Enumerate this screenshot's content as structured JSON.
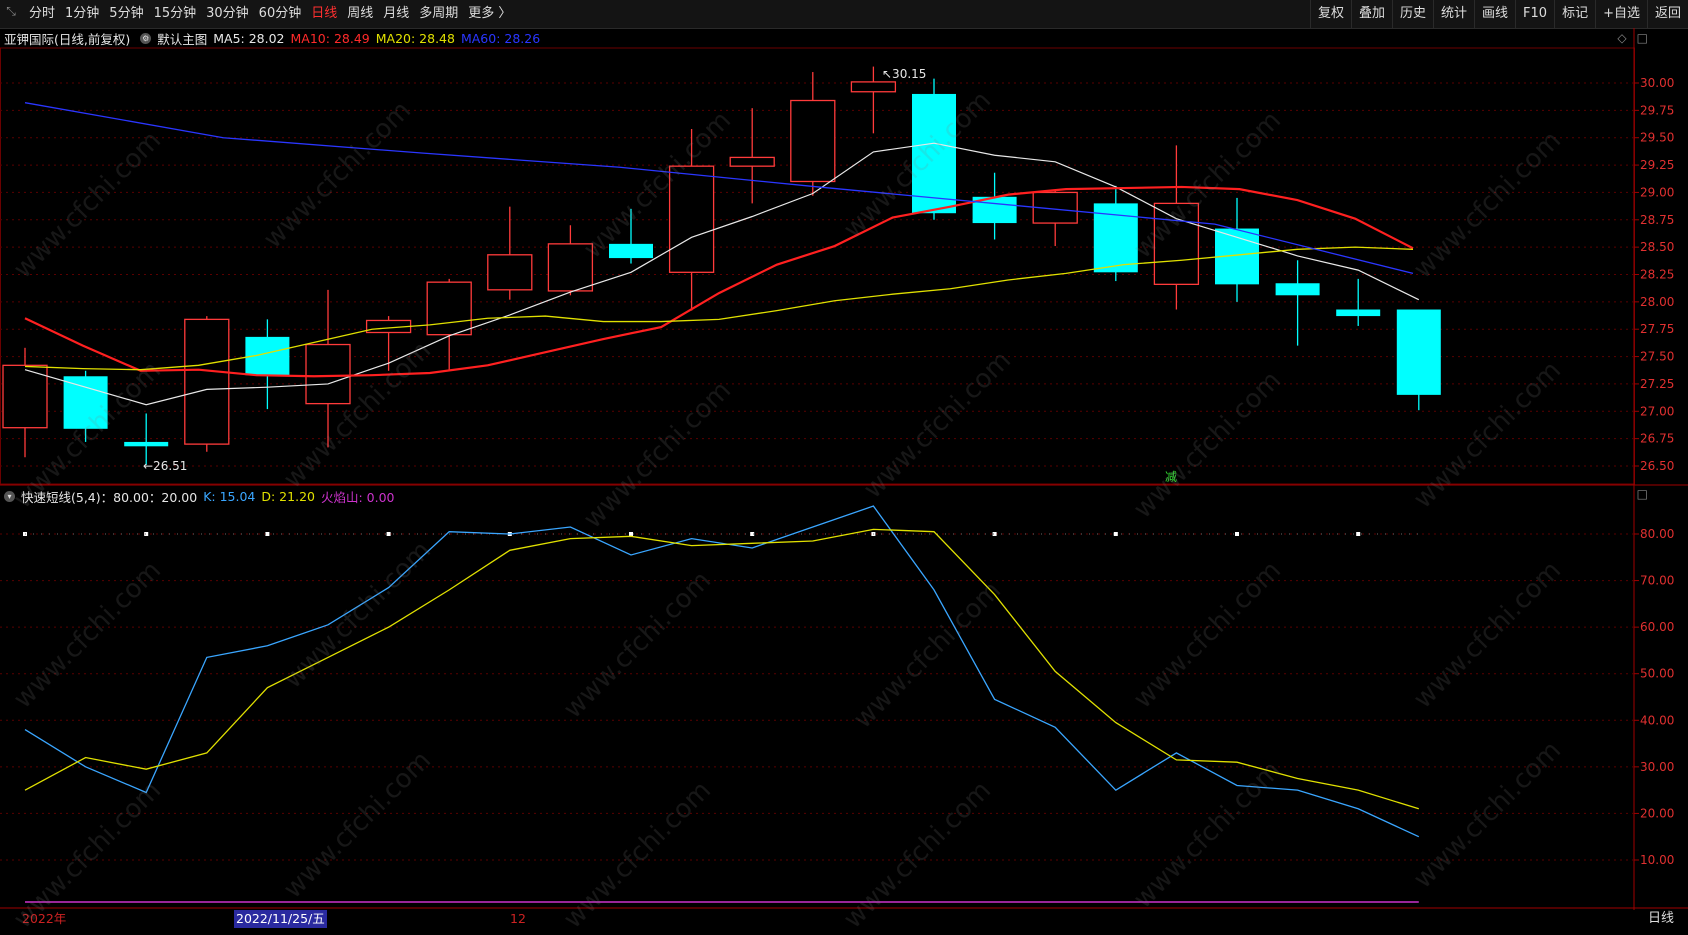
{
  "toolbar": {
    "tabs": [
      {
        "label": "分时"
      },
      {
        "label": "1分钟"
      },
      {
        "label": "5分钟"
      },
      {
        "label": "15分钟"
      },
      {
        "label": "30分钟"
      },
      {
        "label": "60分钟"
      },
      {
        "label": "日线",
        "active": true
      },
      {
        "label": "周线"
      },
      {
        "label": "月线"
      },
      {
        "label": "多周期"
      },
      {
        "label": "更多 〉"
      }
    ],
    "right": [
      {
        "label": "复权"
      },
      {
        "label": "叠加"
      },
      {
        "label": "历史"
      },
      {
        "label": "统计"
      },
      {
        "label": "画线"
      },
      {
        "label": "F10"
      },
      {
        "label": "标记"
      },
      {
        "label": "+自选"
      },
      {
        "label": "返回"
      }
    ]
  },
  "main_legend": {
    "title": "亚钾国际(日线,前复权)",
    "template": "默认主图",
    "ma5": "MA5: 28.02",
    "ma10": "MA10: 28.49",
    "ma20": "MA20: 28.48",
    "ma60": "MA60: 28.26"
  },
  "indicator_legend": {
    "name": "快速短线(5,4)：80.00：20.00",
    "k": "K: 15.04",
    "d": "D: 21.20",
    "fire": "火焰山: 0.00"
  },
  "colors": {
    "up": "#ff3b3b",
    "down": "#00ffff",
    "ma5": "#e8e8e8",
    "ma10": "#ff2020",
    "ma20": "#e0e000",
    "ma60": "#2a36ff",
    "k": "#3aa6ff",
    "d": "#e0e000",
    "fire": "#cc33cc",
    "axis": "#8b0000"
  },
  "price_axis": [
    "30.00",
    "29.75",
    "29.50",
    "29.25",
    "29.00",
    "28.75",
    "28.50",
    "28.25",
    "28.00",
    "27.75",
    "27.50",
    "27.25",
    "27.00",
    "26.75",
    "26.50"
  ],
  "ind_axis": [
    "80.00",
    "70.00",
    "60.00",
    "50.00",
    "40.00",
    "30.00",
    "20.00",
    "10.00"
  ],
  "annotations": {
    "high": "30.15",
    "low": "26.51",
    "signal": "减"
  },
  "x_labels": {
    "year": "2022年",
    "date": "2022/11/25/五",
    "month": "12"
  },
  "period_label": "日线",
  "watermark": "www.cfchi.com",
  "chart_data": {
    "type": "candlestick",
    "ylim": [
      26.4,
      30.25
    ],
    "candles": [
      {
        "o": 26.85,
        "c": 27.42,
        "h": 27.58,
        "l": 26.58
      },
      {
        "o": 27.32,
        "c": 26.84,
        "h": 27.37,
        "l": 26.72
      },
      {
        "o": 26.72,
        "c": 26.68,
        "h": 26.98,
        "l": 26.51
      },
      {
        "o": 26.7,
        "c": 27.84,
        "h": 27.87,
        "l": 26.63
      },
      {
        "o": 27.68,
        "c": 27.33,
        "h": 27.84,
        "l": 27.02
      },
      {
        "o": 27.07,
        "c": 27.61,
        "h": 28.11,
        "l": 26.67
      },
      {
        "o": 27.72,
        "c": 27.83,
        "h": 27.87,
        "l": 27.37
      },
      {
        "o": 27.7,
        "c": 28.18,
        "h": 28.21,
        "l": 27.38
      },
      {
        "o": 28.11,
        "c": 28.43,
        "h": 28.87,
        "l": 28.02
      },
      {
        "o": 28.1,
        "c": 28.53,
        "h": 28.7,
        "l": 28.06
      },
      {
        "o": 28.53,
        "c": 28.4,
        "h": 28.85,
        "l": 28.35
      },
      {
        "o": 28.27,
        "c": 29.24,
        "h": 29.58,
        "l": 27.92
      },
      {
        "o": 29.24,
        "c": 29.32,
        "h": 29.77,
        "l": 28.9
      },
      {
        "o": 29.1,
        "c": 29.84,
        "h": 30.1,
        "l": 28.97
      },
      {
        "o": 29.92,
        "c": 30.01,
        "h": 30.15,
        "l": 29.54
      },
      {
        "o": 29.9,
        "c": 28.81,
        "h": 30.04,
        "l": 28.75
      },
      {
        "o": 28.96,
        "c": 28.72,
        "h": 29.18,
        "l": 28.57
      },
      {
        "o": 28.72,
        "c": 29.0,
        "h": 29.02,
        "l": 28.51
      },
      {
        "o": 28.9,
        "c": 28.27,
        "h": 29.06,
        "l": 28.19
      },
      {
        "o": 28.16,
        "c": 28.9,
        "h": 29.43,
        "l": 27.93
      },
      {
        "o": 28.67,
        "c": 28.16,
        "h": 28.95,
        "l": 28.0
      },
      {
        "o": 28.17,
        "c": 28.06,
        "h": 28.38,
        "l": 27.6
      },
      {
        "o": 27.93,
        "c": 27.87,
        "h": 28.21,
        "l": 27.78
      },
      {
        "o": 27.93,
        "c": 27.15,
        "h": 27.93,
        "l": 27.01
      }
    ],
    "ma5": [
      27.38,
      27.22,
      27.06,
      27.2,
      27.22,
      27.25,
      27.44,
      27.69,
      27.88,
      28.09,
      28.27,
      28.59,
      28.78,
      28.99,
      29.37,
      29.45,
      29.34,
      29.28,
      29.05,
      28.76,
      28.59,
      28.42,
      28.29,
      28.02
    ],
    "ma10": [
      27.85,
      27.6,
      27.37,
      27.38,
      27.33,
      27.32,
      27.33,
      27.35,
      27.42,
      27.54,
      27.66,
      27.77,
      28.08,
      28.34,
      28.51,
      28.77,
      28.87,
      28.98,
      29.03,
      29.04,
      29.05,
      29.03,
      28.93,
      28.76,
      28.49
    ],
    "ma20": [
      27.41,
      27.39,
      27.38,
      27.42,
      27.51,
      27.63,
      27.75,
      27.79,
      27.85,
      27.87,
      27.82,
      27.82,
      27.84,
      27.92,
      28.01,
      28.07,
      28.12,
      28.2,
      28.26,
      28.34,
      28.38,
      28.43,
      28.48,
      28.5,
      28.48
    ],
    "ma60": [
      29.82,
      29.5,
      29.36,
      29.23,
      29.05,
      28.88,
      28.71,
      28.26
    ],
    "k": [
      38,
      30,
      24.5,
      53.5,
      56,
      60.5,
      68.5,
      80.5,
      80,
      81.5,
      75.5,
      79,
      77,
      81.5,
      86,
      68,
      44.5,
      38.5,
      25,
      33,
      26,
      25,
      21,
      15
    ],
    "d": [
      25,
      32,
      29.5,
      33,
      47,
      53.5,
      60,
      68,
      76.5,
      79,
      79.5,
      77.5,
      78,
      78.5,
      81,
      80.5,
      67,
      50.5,
      39.5,
      31.5,
      31,
      27.5,
      25,
      21
    ],
    "ind_ylim": [
      0,
      90
    ]
  }
}
